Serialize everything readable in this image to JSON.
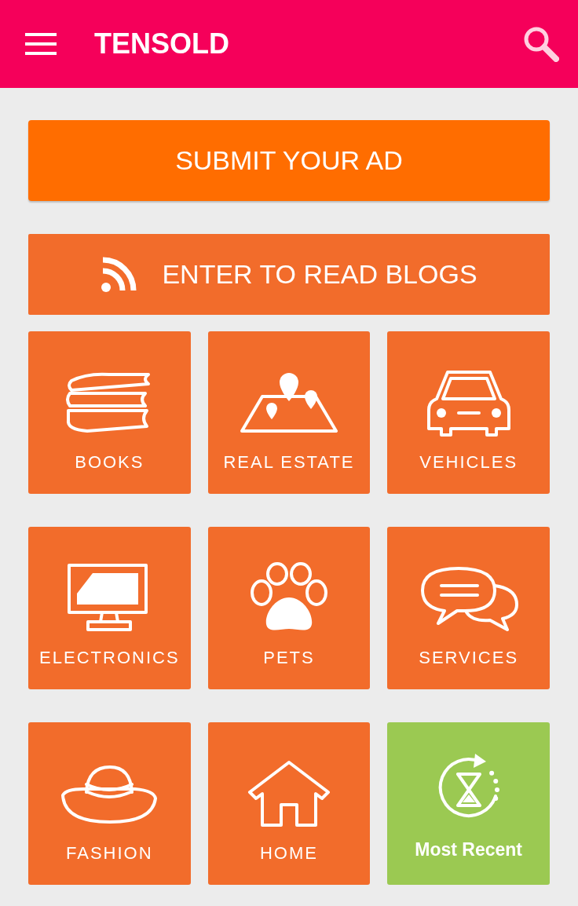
{
  "app_bar": {
    "title": "TENSOLD"
  },
  "submit_button": {
    "label": "SUBMIT YOUR AD"
  },
  "blogs_button": {
    "label": "ENTER TO READ BLOGS"
  },
  "tiles": [
    {
      "kind": "books",
      "label": "BOOKS"
    },
    {
      "kind": "real_estate",
      "label": "REAL ESTATE"
    },
    {
      "kind": "vehicles",
      "label": "VEHICLES"
    },
    {
      "kind": "electronics",
      "label": "ELECTRONICS"
    },
    {
      "kind": "pets",
      "label": "PETS"
    },
    {
      "kind": "services",
      "label": "SERVICES"
    },
    {
      "kind": "fashion",
      "label": "FASHION"
    },
    {
      "kind": "home",
      "label": "HOME"
    },
    {
      "kind": "recent",
      "label": "Most Recent"
    }
  ]
}
